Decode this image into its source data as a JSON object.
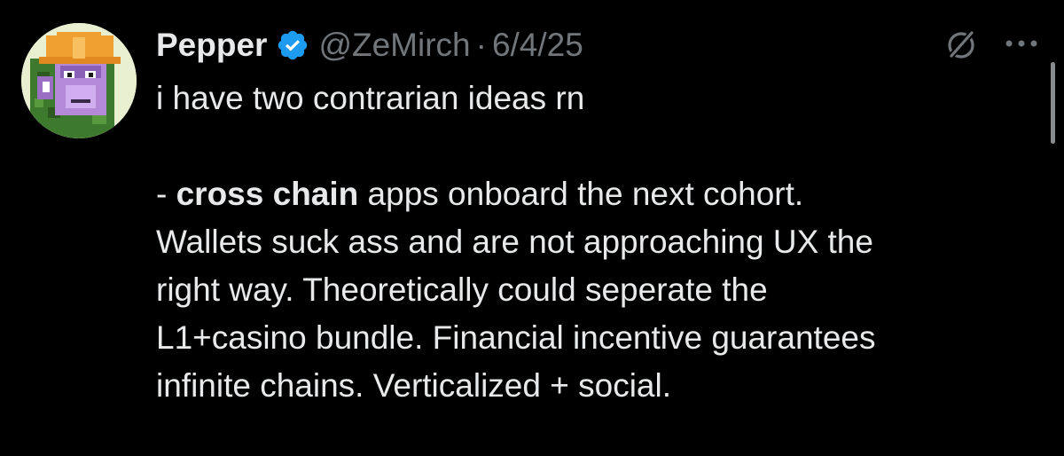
{
  "tweet": {
    "display_name": "Pepper",
    "handle": "@ZeMirch",
    "separator": "·",
    "date": "6/4/25",
    "line1": "i have two contrarian ideas rn",
    "bullet_prefix": "- ",
    "bullet_bold": "cross chain",
    "bullet_rest": " apps onboard the next cohort.",
    "line3": "Wallets suck ass and are not approaching UX the",
    "line4": "right way. Theoretically could seperate the",
    "line5": "L1+casino bundle. Financial incentive guarantees",
    "line6": "infinite chains. Verticalized + social."
  },
  "icons": {
    "verified": "verified-badge-icon",
    "grok": "grok-icon",
    "more": "more-options-icon"
  },
  "colors": {
    "background": "#000000",
    "primary_text": "#e7e9ea",
    "secondary_text": "#71767b",
    "verified_blue": "#1d9bf0"
  }
}
